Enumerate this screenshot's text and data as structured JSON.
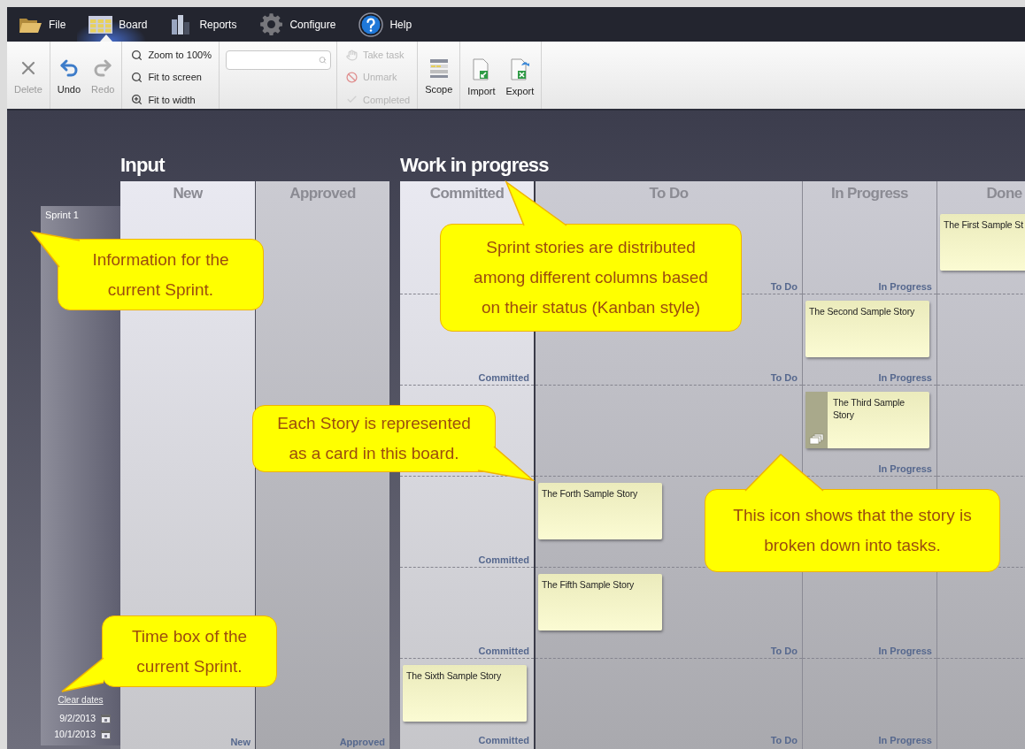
{
  "menu": [
    {
      "label": "File",
      "selected": false
    },
    {
      "label": "Board",
      "selected": true
    },
    {
      "label": "Reports",
      "selected": false
    },
    {
      "label": "Configure",
      "selected": false
    },
    {
      "label": "Help",
      "selected": false
    }
  ],
  "toolbar": {
    "edit": [
      {
        "label": "Delete",
        "disabled": true
      },
      {
        "label": "Undo",
        "disabled": false
      },
      {
        "label": "Redo",
        "disabled": true
      }
    ],
    "zoom": [
      {
        "label": "Zoom to 100%"
      },
      {
        "label": "Fit to screen"
      },
      {
        "label": "Fit to width"
      }
    ],
    "task_actions": [
      {
        "label": "Take task",
        "disabled": true
      },
      {
        "label": "Unmark",
        "disabled": true
      },
      {
        "label": "Completed",
        "disabled": true
      }
    ],
    "scope": {
      "label": "Scope"
    },
    "transfer": [
      {
        "label": "Import"
      },
      {
        "label": "Export"
      }
    ]
  },
  "board": {
    "sprint": {
      "name": "Sprint 1",
      "clear_dates": "Clear dates",
      "dates": [
        "9/2/2013",
        "10/1/2013"
      ]
    },
    "input": {
      "title": "Input",
      "columns": [
        {
          "header": "New",
          "footer": "New"
        },
        {
          "header": "Approved",
          "footer": "Approved"
        }
      ]
    },
    "wip": {
      "title": "Work in progress",
      "columns": [
        {
          "header": "Committed"
        },
        {
          "header": "To Do"
        },
        {
          "header": "In Progress"
        },
        {
          "header": "Done"
        }
      ],
      "lanes": [
        {
          "cells": [
            {},
            {
              "label": "To Do"
            },
            {
              "label": "In Progress"
            },
            {
              "card": {
                "title": "The First Sample St",
                "has_tasks": false
              }
            }
          ]
        },
        {
          "cells": [
            {
              "label": "Committed"
            },
            {
              "label": "To Do"
            },
            {
              "label": "In Progress",
              "card": {
                "title": "The Second Sample Story",
                "has_tasks": false
              }
            },
            {}
          ]
        },
        {
          "cells": [
            {},
            {},
            {
              "label": "In Progress",
              "card": {
                "title": "The Third Sample Story",
                "has_tasks": true
              }
            },
            {}
          ]
        },
        {
          "cells": [
            {
              "label": "Committed"
            },
            {
              "card": {
                "title": "The Forth Sample Story",
                "has_tasks": false
              }
            },
            {},
            {}
          ]
        },
        {
          "cells": [
            {
              "label": "Committed"
            },
            {
              "label": "To Do",
              "card": {
                "title": "The Fifth Sample Story",
                "has_tasks": false
              }
            },
            {
              "label": "In Progress"
            },
            {}
          ]
        },
        {
          "cells": [
            {
              "label": "Committed",
              "card": {
                "title": "The Sixth Sample Story",
                "has_tasks": false
              }
            },
            {
              "label": "To Do"
            },
            {
              "label": "In Progress"
            },
            {}
          ]
        }
      ]
    }
  },
  "callouts": [
    {
      "text": "Information for the current Sprint."
    },
    {
      "text": "Sprint stories are distributed among different columns based on their status (Kanban style)"
    },
    {
      "text": "Each Story is represented as a card in this board."
    },
    {
      "text": "This icon shows that the story is broken down into tasks."
    },
    {
      "text": "Time box of the current Sprint."
    }
  ]
}
